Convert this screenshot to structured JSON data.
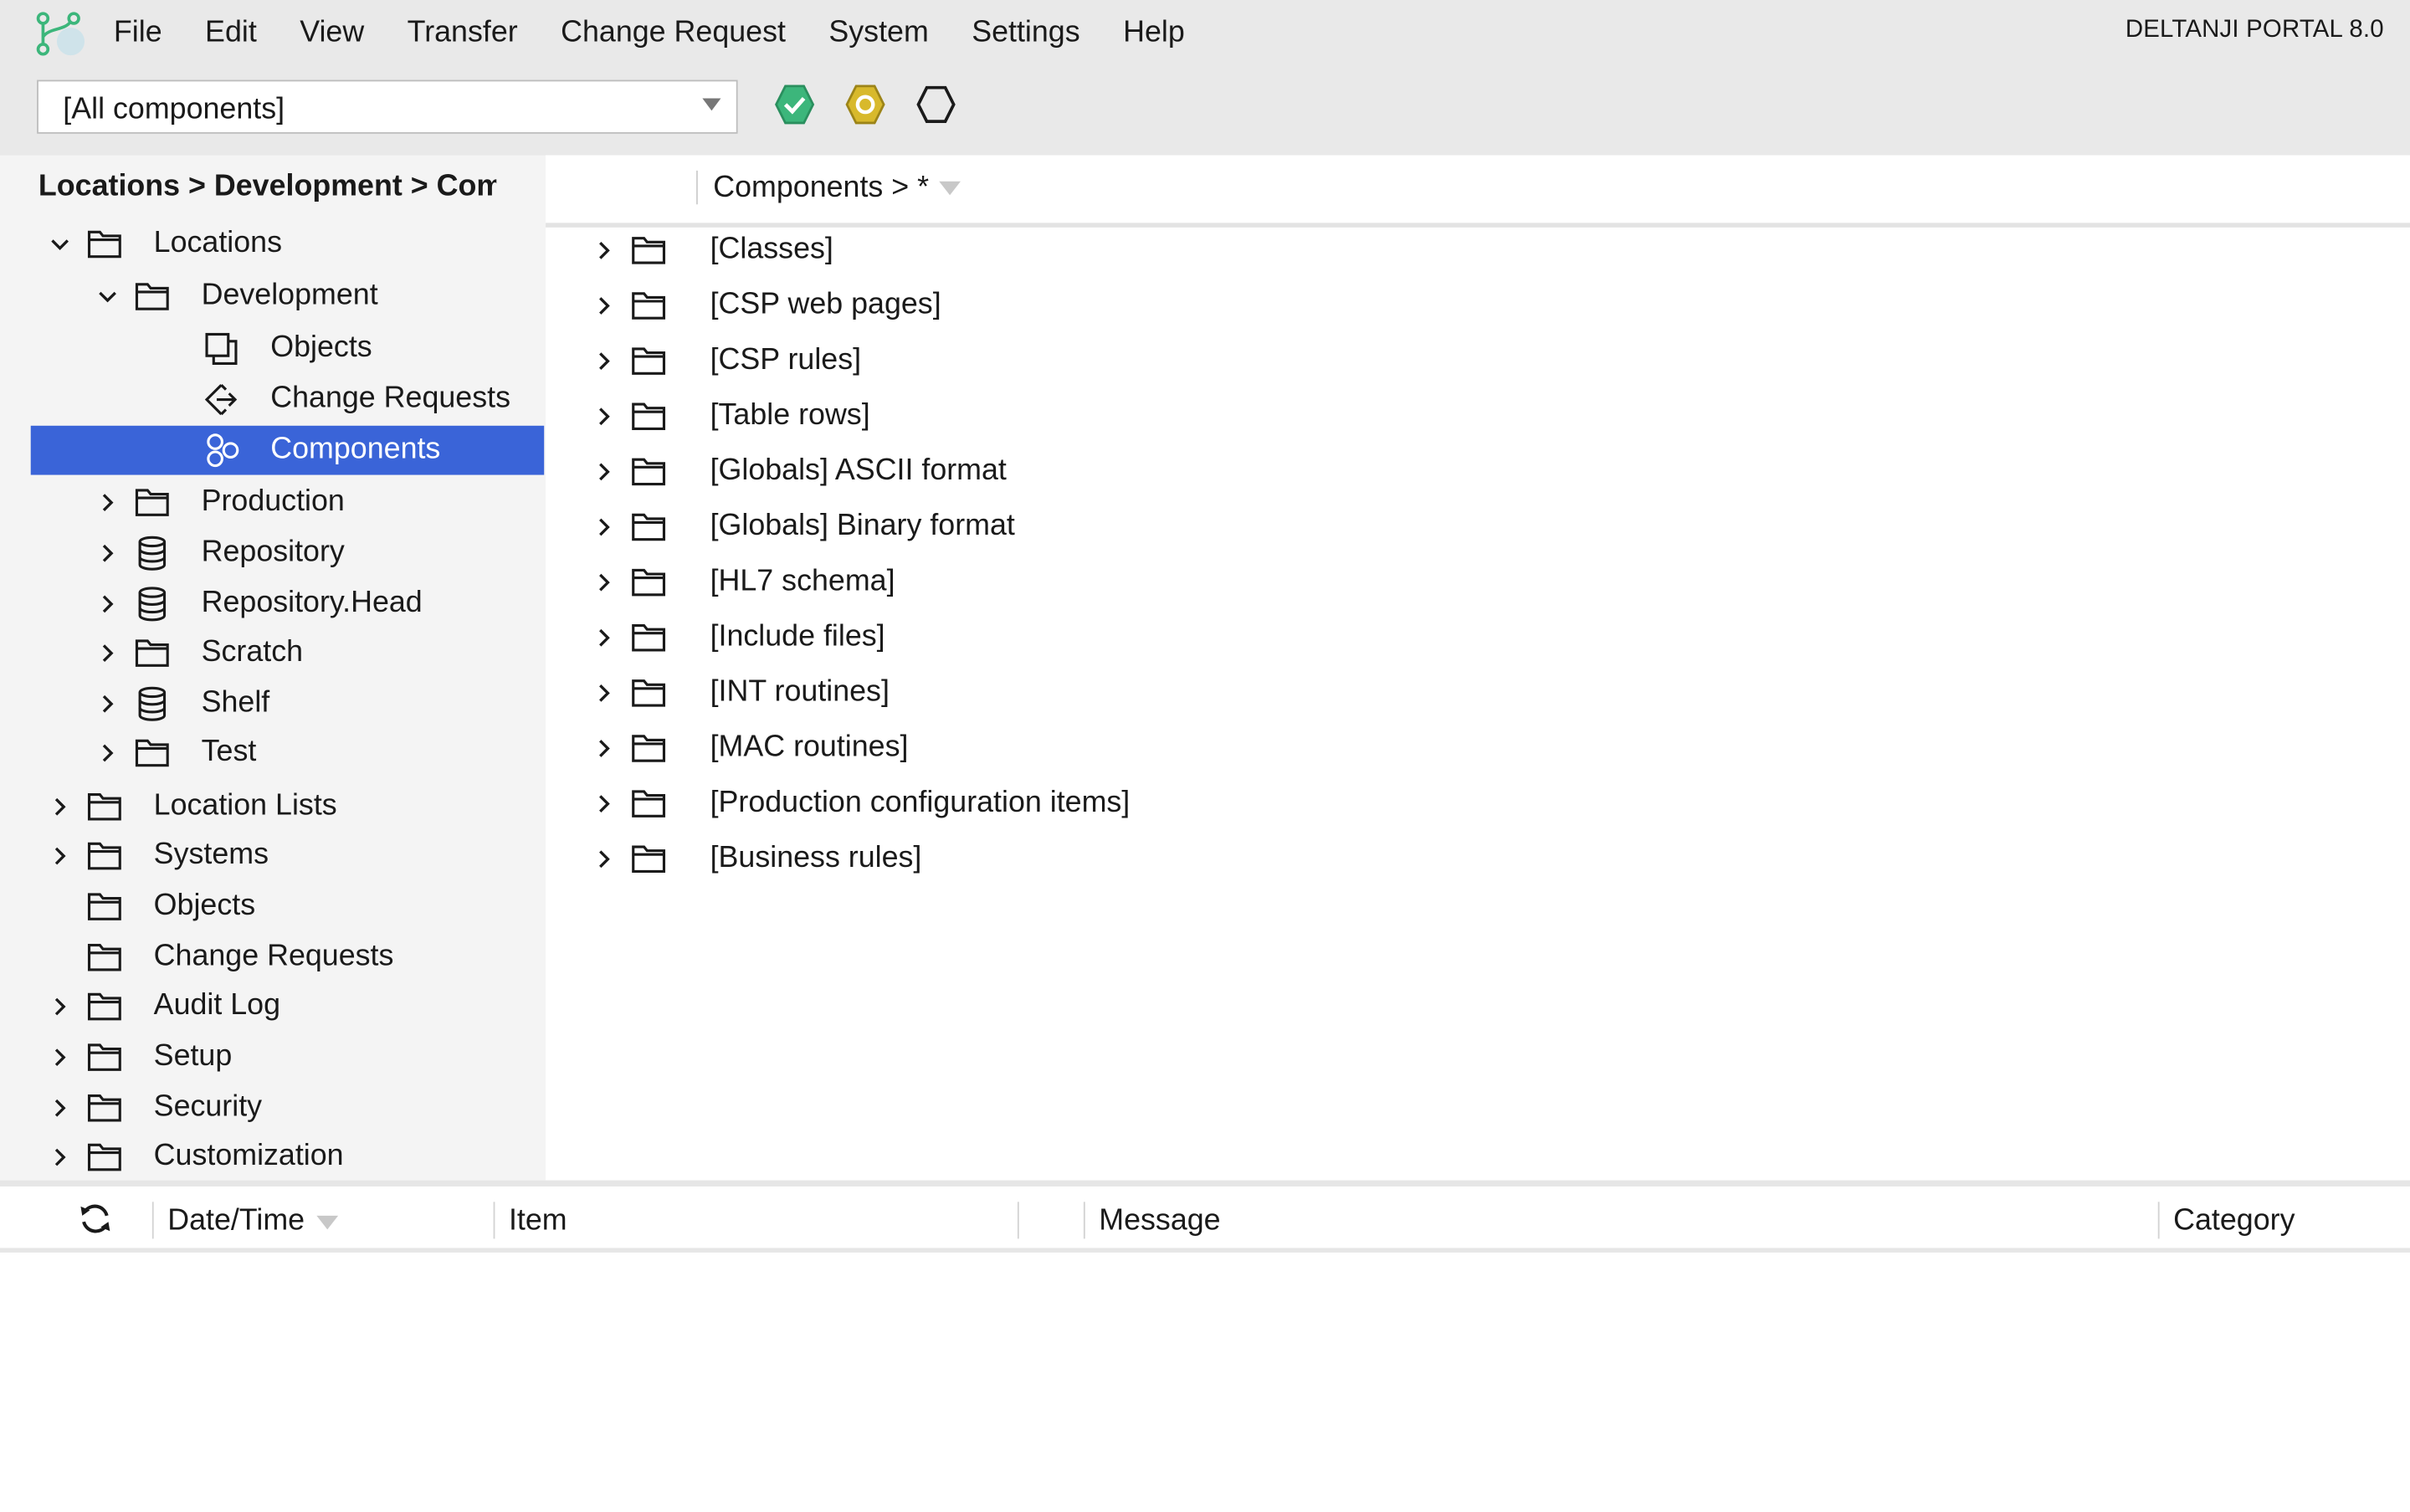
{
  "app": {
    "brand": "DELTANJI PORTAL 8.0",
    "accent_color": "#3a64d8",
    "logo_icon": "deltanji-logo-icon"
  },
  "menu": [
    "File",
    "Edit",
    "View",
    "Transfer",
    "Change Request",
    "System",
    "Settings",
    "Help"
  ],
  "toolbar": {
    "component_filter": "[All components]",
    "status_icons": [
      {
        "name": "check-hexagon-icon",
        "color": "#3cb67b"
      },
      {
        "name": "warning-hexagon-icon",
        "color": "#d8b92c"
      },
      {
        "name": "empty-hexagon-icon",
        "color": "#1a1a1a"
      }
    ]
  },
  "breadcrumb": "Locations > Development > Components",
  "tree": [
    {
      "label": "Locations",
      "icon": "folder-icon",
      "expander": "expanded"
    },
    {
      "label": "Development",
      "icon": "folder-icon",
      "expander": "expanded"
    },
    {
      "label": "Objects",
      "icon": "objects-icon",
      "expander": "none"
    },
    {
      "label": "Change Requests",
      "icon": "change-request-icon",
      "expander": "none"
    },
    {
      "label": "Components",
      "icon": "components-icon",
      "expander": "none",
      "selected": true
    },
    {
      "label": "Production",
      "icon": "folder-icon",
      "expander": "collapsed"
    },
    {
      "label": "Repository",
      "icon": "database-icon",
      "expander": "collapsed"
    },
    {
      "label": "Repository.Head",
      "icon": "database-icon",
      "expander": "collapsed"
    },
    {
      "label": "Scratch",
      "icon": "folder-icon",
      "expander": "collapsed"
    },
    {
      "label": "Shelf",
      "icon": "database-icon",
      "expander": "collapsed"
    },
    {
      "label": "Test",
      "icon": "folder-icon",
      "expander": "collapsed"
    },
    {
      "label": "Location Lists",
      "icon": "folder-icon",
      "expander": "collapsed"
    },
    {
      "label": "Systems",
      "icon": "folder-icon",
      "expander": "collapsed"
    },
    {
      "label": "Objects",
      "icon": "folder-icon",
      "expander": "none"
    },
    {
      "label": "Change Requests",
      "icon": "folder-icon",
      "expander": "none"
    },
    {
      "label": "Audit Log",
      "icon": "folder-icon",
      "expander": "collapsed"
    },
    {
      "label": "Setup",
      "icon": "folder-icon",
      "expander": "collapsed"
    },
    {
      "label": "Security",
      "icon": "folder-icon",
      "expander": "collapsed"
    },
    {
      "label": "Customization",
      "icon": "folder-icon",
      "expander": "collapsed"
    }
  ],
  "main": {
    "path": "Components > *",
    "items": [
      "[Classes]",
      "[CSP web pages]",
      "[CSP rules]",
      "[Table rows]",
      "[Globals] ASCII format",
      "[Globals] Binary format",
      "[HL7 schema]",
      "[Include files]",
      "[INT routines]",
      "[MAC routines]",
      "[Production configuration items]",
      "[Business rules]"
    ]
  },
  "log": {
    "refresh_icon": "refresh-icon",
    "columns": {
      "datetime": "Date/Time",
      "item": "Item",
      "message": "Message",
      "category": "Category"
    }
  }
}
